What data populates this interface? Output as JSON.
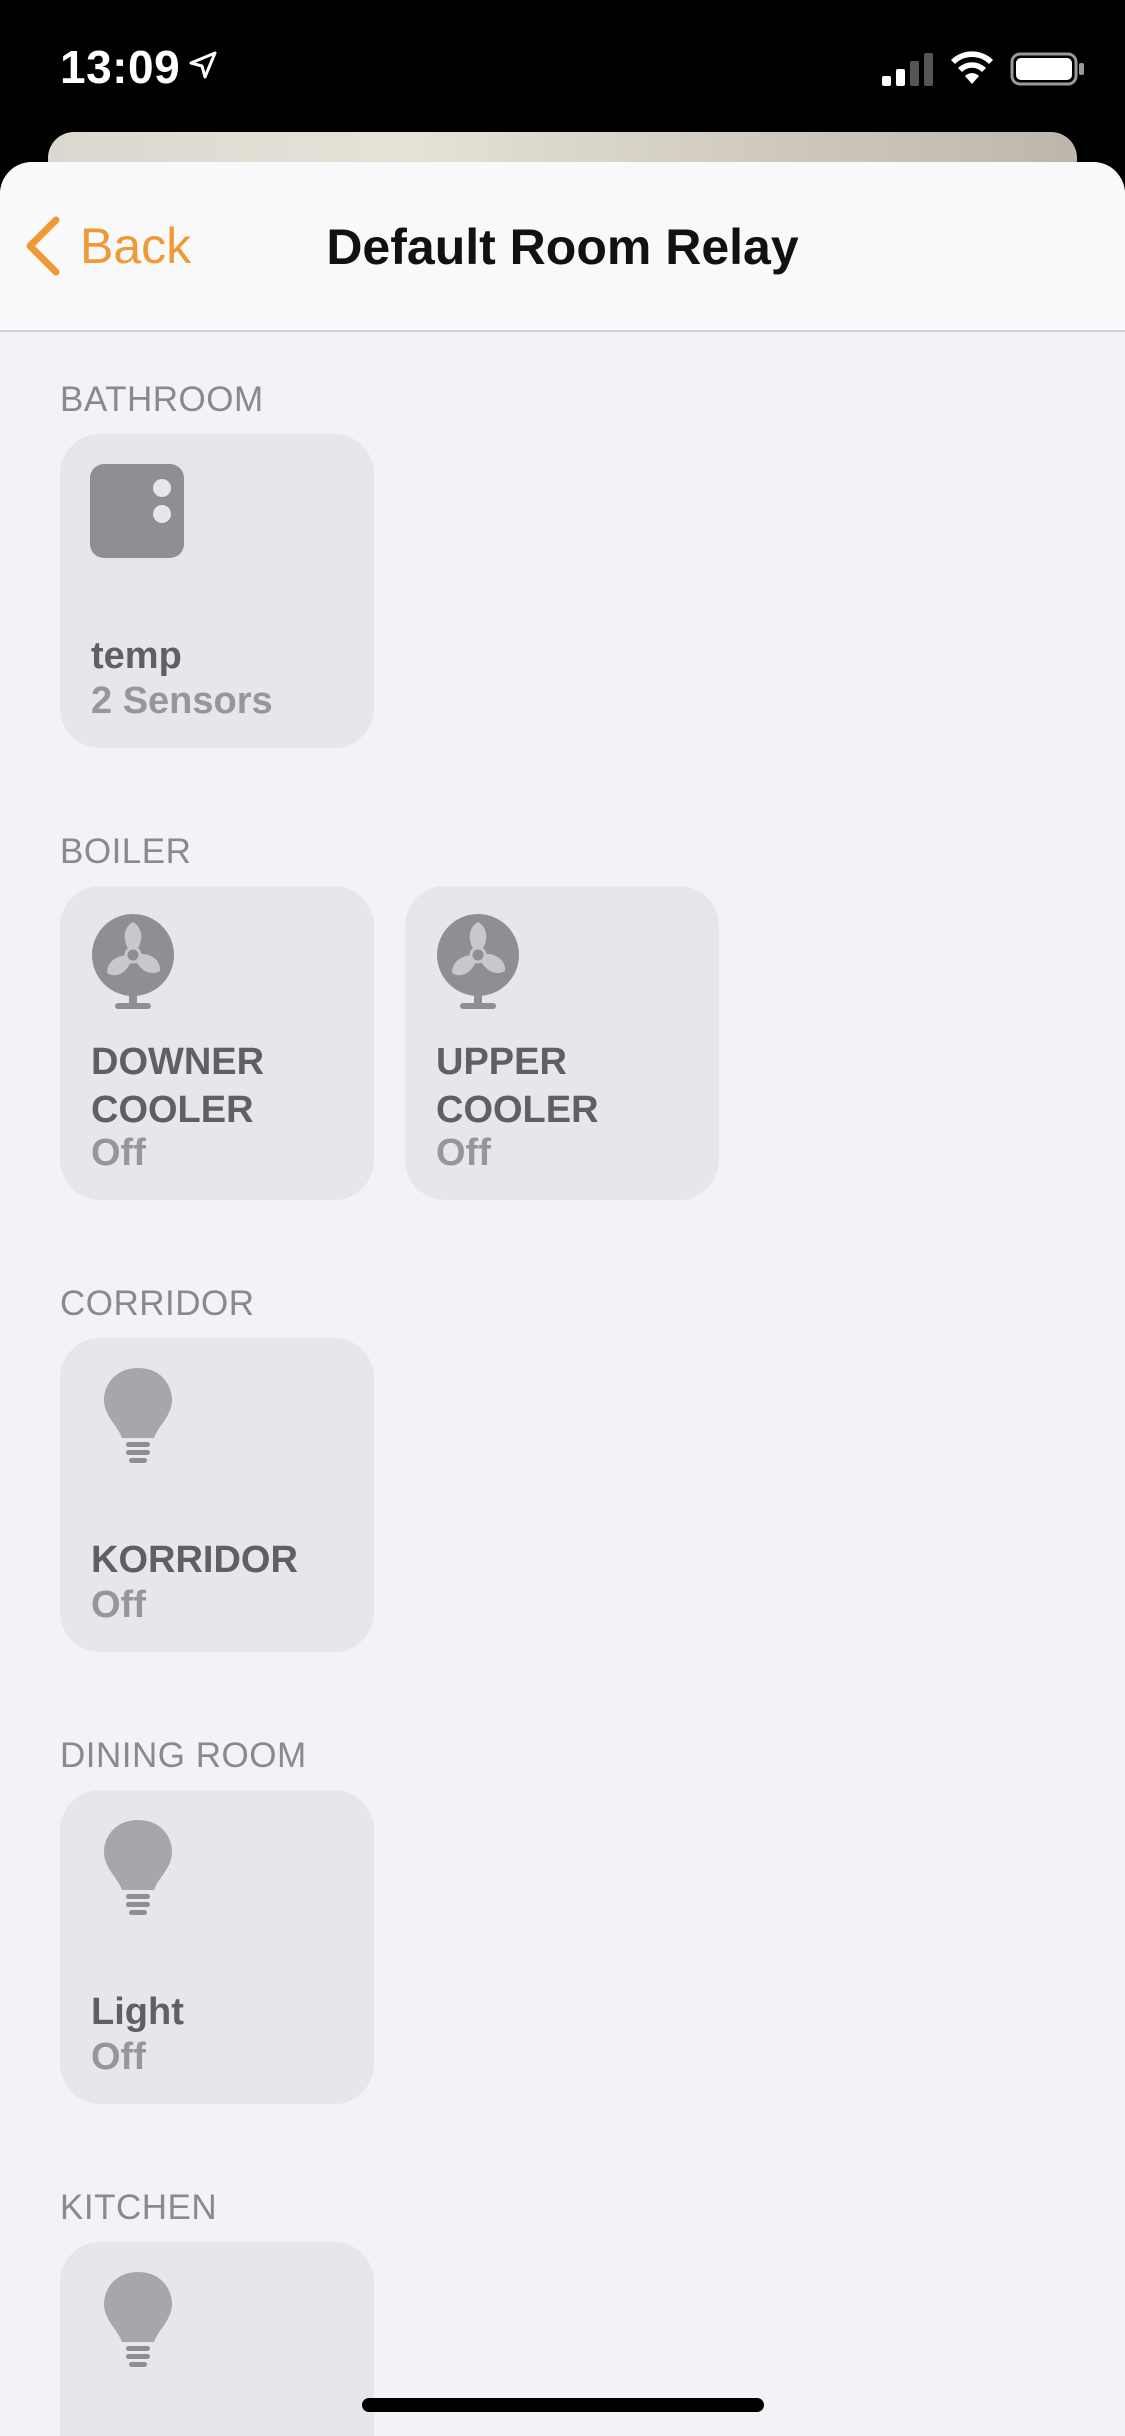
{
  "status_bar": {
    "time": "13:09",
    "icons": [
      "location-arrow-icon",
      "signal-icon",
      "wifi-icon",
      "battery-icon"
    ]
  },
  "nav": {
    "back_label": "Back",
    "title": "Default Room Relay",
    "accent_color": "#f09a37"
  },
  "sections": [
    {
      "header": "BATHROOM",
      "tiles": [
        {
          "icon": "sensor-icon",
          "name": "temp",
          "status": "2 Sensors"
        }
      ]
    },
    {
      "header": "BOILER",
      "tiles": [
        {
          "icon": "fan-icon",
          "name": "DOWNER COOLER",
          "status": "Off"
        },
        {
          "icon": "fan-icon",
          "name": "UPPER COOLER",
          "status": "Off"
        }
      ]
    },
    {
      "header": "CORRIDOR",
      "tiles": [
        {
          "icon": "lightbulb-icon",
          "name": "KORRIDOR",
          "status": "Off"
        }
      ]
    },
    {
      "header": "DINING ROOM",
      "tiles": [
        {
          "icon": "lightbulb-icon",
          "name": "Light",
          "status": "Off"
        }
      ]
    },
    {
      "header": "KITCHEN",
      "tiles": [
        {
          "icon": "lightbulb-icon",
          "name": "",
          "status": ""
        }
      ]
    }
  ]
}
